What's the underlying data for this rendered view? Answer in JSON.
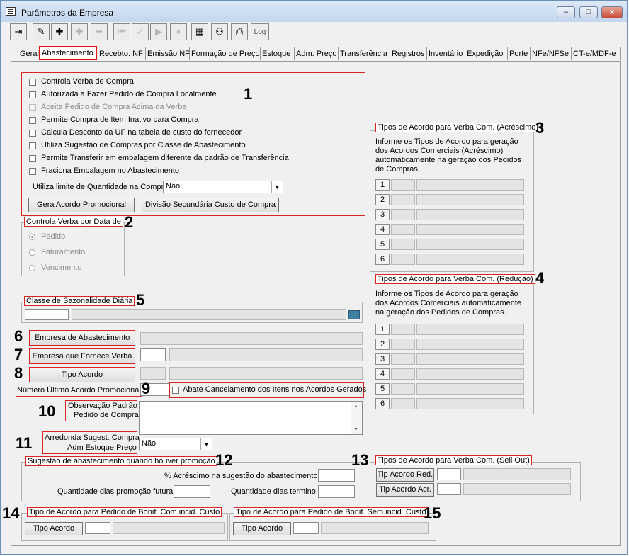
{
  "window": {
    "title": "Parâmetros da Empresa",
    "minimize": "–",
    "maximize": "□",
    "close": "x"
  },
  "toolbar": {
    "log_label": "Log"
  },
  "tabs": [
    "Geral",
    "Abastecimento",
    "Recebto. NF",
    "Emissão NF",
    "Formação de Preço",
    "Estoque",
    "Adm. Preço",
    "Transferência",
    "Registros",
    "Inventário",
    "Expedição",
    "Porte",
    "NFe/NFSe",
    "CT-e/MDF-e"
  ],
  "annotations": [
    "1",
    "2",
    "3",
    "4",
    "5",
    "6",
    "7",
    "8",
    "9",
    "10",
    "11",
    "12",
    "13",
    "14",
    "15"
  ],
  "group1": {
    "checkboxes": [
      {
        "label": "Controla Verba de Compra",
        "disabled": false
      },
      {
        "label": "Autorizada a Fazer Pedido de Compra Localmente",
        "disabled": false
      },
      {
        "label": "Aceita Pedido de Compra Acima da Verba",
        "disabled": true
      },
      {
        "label": "Permite Compra de Item Inativo para Compra",
        "disabled": false
      },
      {
        "label": "Calcula Desconto da UF na tabela de custo do fornecedor",
        "disabled": false
      },
      {
        "label": "Utiliza Sugestão de Compras por Classe de Abastecimento",
        "disabled": false
      },
      {
        "label": "Permite Transferir em embalagem diferente da padrão de Transferência",
        "disabled": false
      },
      {
        "label": "Fraciona Embalagem no Abastecimento",
        "disabled": false
      }
    ],
    "limit_label": "Utiliza limite de Quantidade na Compra",
    "limit_value": "Não",
    "btn_acordo": "Gera Acordo Promocional",
    "btn_divisao": "Divisão Secundária Custo de Compra"
  },
  "group2": {
    "title": "Controla Verba por Data de",
    "options": [
      "Pedido",
      "Faturamento",
      "Vencimento"
    ]
  },
  "group3": {
    "title": "Tipos de Acordo para Verba Com. (Acréscimo)",
    "desc": [
      "Informe os Tipos de Acordo para geração",
      "dos Acordos Comerciais (Acréscimo)",
      "automaticamente na geração dos Pedidos",
      "de Compras."
    ],
    "rows": [
      "1",
      "2",
      "3",
      "4",
      "5",
      "6"
    ]
  },
  "group4": {
    "title": "Tipos de Acordo para Verba Com. (Redução)",
    "desc": [
      "Informe os Tipos de Acordo para geração",
      "dos Acordos Comerciais automaticamente",
      "na geração dos Pedidos de Compras."
    ],
    "rows": [
      "1",
      "2",
      "3",
      "4",
      "5",
      "6"
    ]
  },
  "group5": {
    "title": "Classe de Sazonalidade Diária"
  },
  "fields": {
    "empresa_abastecimento": "Empresa de Abastecimento",
    "empresa_fornece_verba": "Empresa que Fornece Verba",
    "tipo_acordo": "Tipo Acordo",
    "numero_ultimo_acordo": "Número Último Acordo Promocional",
    "abate_cancelamento": "Abate Cancelamento dos Itens nos Acordos Gerados",
    "observacao_line1": "Observação Padrão",
    "observacao_line2": "Pedido de Compra",
    "arredonda_line1": "Arredonda Sugest. Compra",
    "arredonda_line2": "Adm Estoque Preço",
    "arredonda_value": "Não"
  },
  "group12": {
    "title": "Sugestão de abastecimento quando houver promoção",
    "acrescimo": "% Acréscimo na sugestão do abastecimento",
    "dias_promocao": "Quantidade dias promoção futura",
    "dias_termino": "Quantidade dias termino"
  },
  "group13": {
    "title": "Tipos de Acordo para Verba Com. (Sell Out)",
    "btn_red": "Tip Acordo Red.",
    "btn_acr": "Tip Acordo Acr."
  },
  "group14": {
    "title": "Tipo de Acordo para Pedido de Bonif. Com incid. Custo",
    "btn": "Tipo Acordo"
  },
  "group15": {
    "title": "Tipo de Acordo para Pedido de Bonif. Sem incid. Custo",
    "btn": "Tipo Acordo"
  }
}
